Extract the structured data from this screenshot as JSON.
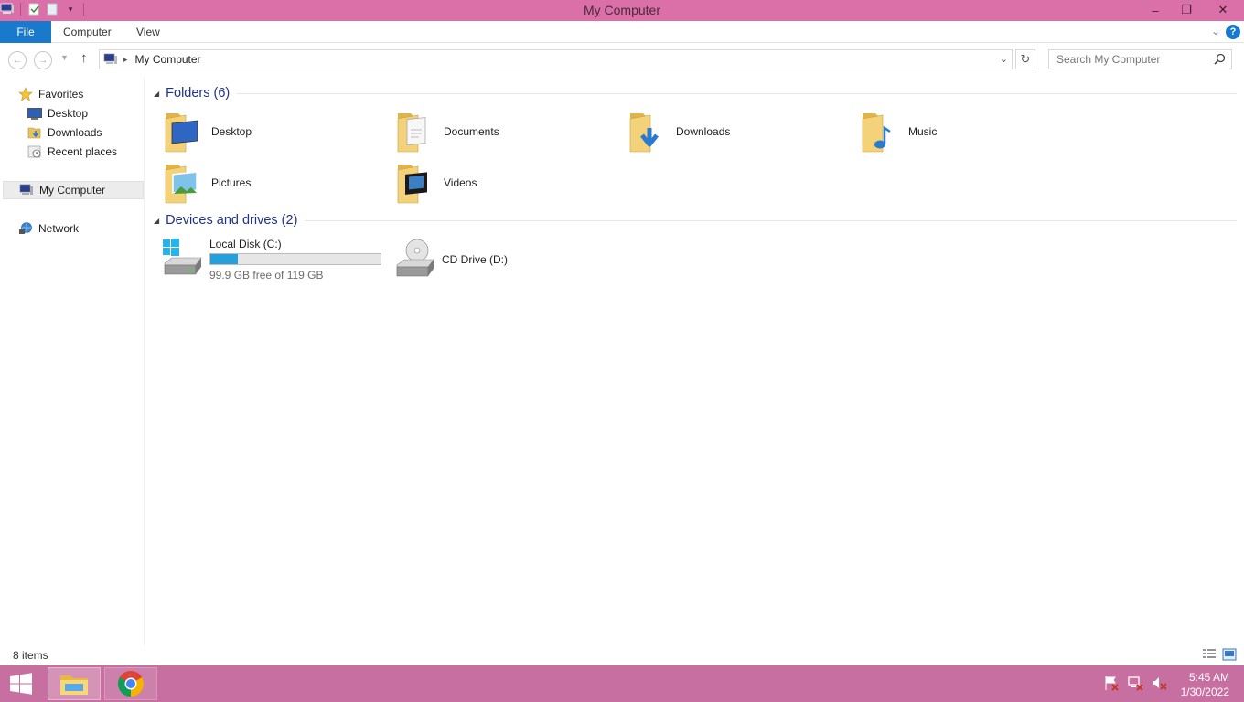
{
  "window": {
    "title": "My Computer"
  },
  "window_controls": {
    "minimize": "–",
    "restore": "❐",
    "close": "✕"
  },
  "ribbon": {
    "tabs": [
      {
        "label": "File"
      },
      {
        "label": "Computer"
      },
      {
        "label": "View"
      }
    ],
    "help_glyph": "?"
  },
  "address": {
    "breadcrumb": "My Computer",
    "search_placeholder": "Search My Computer"
  },
  "nav_pane": {
    "favorites_label": "Favorites",
    "favorites": [
      {
        "label": "Desktop",
        "icon": "desktop-icon"
      },
      {
        "label": "Downloads",
        "icon": "downloads-icon"
      },
      {
        "label": "Recent places",
        "icon": "recent-places-icon"
      }
    ],
    "my_computer": "My Computer",
    "network": "Network"
  },
  "folders_group": {
    "title": "Folders (6)",
    "items": [
      {
        "label": "Desktop",
        "icon": "desktop-folder-icon"
      },
      {
        "label": "Documents",
        "icon": "documents-folder-icon"
      },
      {
        "label": "Downloads",
        "icon": "downloads-folder-icon"
      },
      {
        "label": "Music",
        "icon": "music-folder-icon"
      },
      {
        "label": "Pictures",
        "icon": "pictures-folder-icon"
      },
      {
        "label": "Videos",
        "icon": "videos-folder-icon"
      }
    ]
  },
  "drives_group": {
    "title": "Devices and drives (2)",
    "local_disk": {
      "label": "Local Disk (C:)",
      "free_text": "99.9 GB free of 119 GB",
      "used_fraction": 0.16
    },
    "cd_drive": {
      "label": "CD Drive (D:)"
    }
  },
  "status": {
    "item_count": "8 items"
  },
  "taskbar": {
    "time": "5:45 AM",
    "date": "1/30/2022"
  },
  "colors": {
    "titlebar": "#db6fa8",
    "taskbar": "#c86fa1",
    "accent": "#1979ca",
    "group_title": "#1e3287",
    "drive_fill": "#26a0da"
  }
}
